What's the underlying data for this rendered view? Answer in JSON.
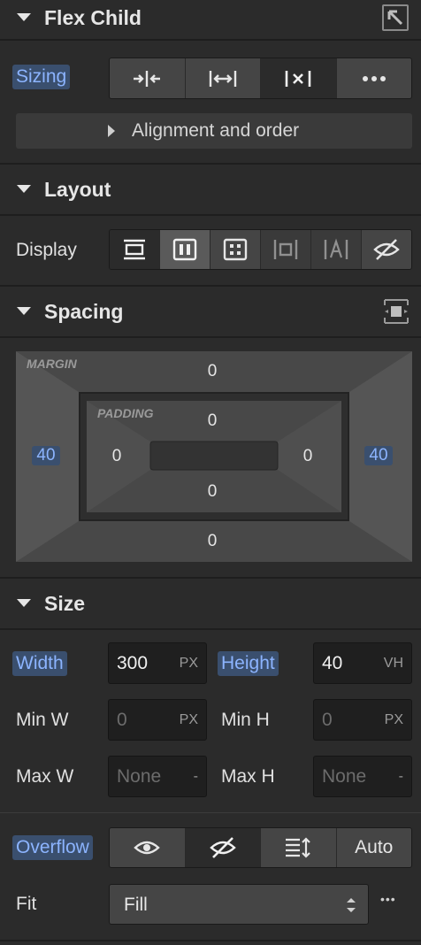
{
  "flex_child": {
    "title": "Flex Child",
    "sizing_label": "Sizing",
    "alignment_label": "Alignment and order"
  },
  "layout": {
    "title": "Layout",
    "display_label": "Display"
  },
  "spacing": {
    "title": "Spacing",
    "margin_label": "MARGIN",
    "padding_label": "PADDING",
    "margin": {
      "top": "0",
      "right": "40",
      "bottom": "0",
      "left": "40"
    },
    "padding": {
      "top": "0",
      "right": "0",
      "bottom": "0",
      "left": "0"
    }
  },
  "size": {
    "title": "Size",
    "width_label": "Width",
    "width_value": "300",
    "width_unit": "PX",
    "height_label": "Height",
    "height_value": "40",
    "height_unit": "VH",
    "min_w_label": "Min W",
    "min_w_value": "0",
    "min_w_unit": "PX",
    "min_h_label": "Min H",
    "min_h_value": "0",
    "min_h_unit": "PX",
    "max_w_label": "Max W",
    "max_w_value": "None",
    "max_w_unit": "-",
    "max_h_label": "Max H",
    "max_h_value": "None",
    "max_h_unit": "-",
    "overflow_label": "Overflow",
    "overflow_auto": "Auto",
    "fit_label": "Fit",
    "fit_value": "Fill",
    "more": "•••"
  },
  "colors": {
    "accent_text": "#8cb4ff",
    "accent_bg": "#3a4f6e",
    "panel_bg": "#2b2b2b"
  }
}
